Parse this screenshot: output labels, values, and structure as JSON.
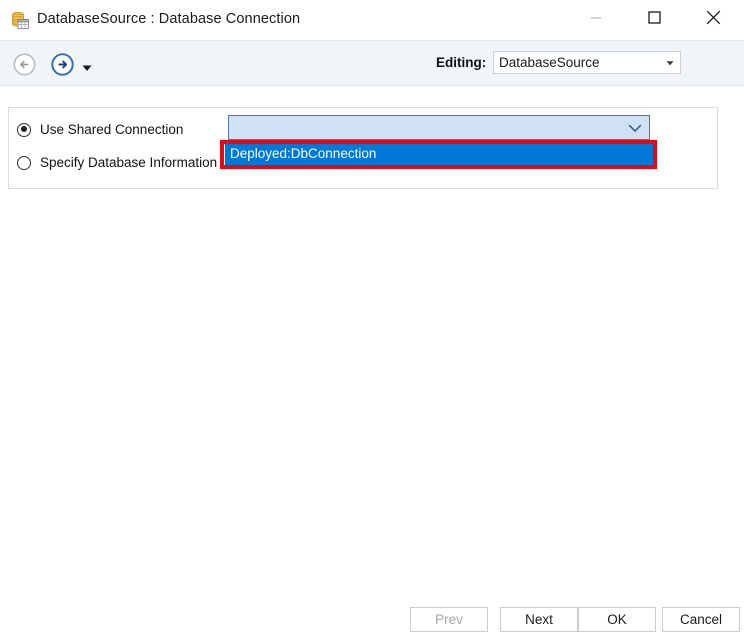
{
  "window": {
    "title": "DatabaseSource : Database Connection",
    "icon": "database-table-icon",
    "controls": {
      "minimize": "minimize-icon",
      "maximize": "maximize-icon",
      "close": "close-icon"
    }
  },
  "toolbar": {
    "back_icon": "back-arrow-icon",
    "forward_icon": "forward-arrow-icon",
    "history_caret_icon": "chevron-down-icon",
    "editing_label": "Editing:",
    "editing_value": "DatabaseSource",
    "editing_dropdown_icon": "chevron-down-icon"
  },
  "options": {
    "radios": [
      {
        "label": "Use Shared Connection",
        "checked": true
      },
      {
        "label": "Specify Database Information",
        "checked": false
      }
    ]
  },
  "connection_combo": {
    "value": "",
    "placeholder": "",
    "chevron_icon": "chevron-down-icon",
    "expanded": true,
    "items": [
      {
        "label": "Deployed:DbConnection",
        "selected": true
      }
    ]
  },
  "annotation": {
    "shape": "rectangle",
    "color": "#e50914",
    "target": "Deployed:DbConnection"
  },
  "footer": {
    "buttons": [
      {
        "label": "Prev",
        "enabled": false
      },
      {
        "label": "Next",
        "enabled": true
      },
      {
        "label": "OK",
        "enabled": true
      },
      {
        "label": "Cancel",
        "enabled": true
      }
    ]
  },
  "colors": {
    "accent_highlight": "#0078d7",
    "combo_fill": "#cfe2f5",
    "annotation": "#e50914",
    "toolbar_bg": "#f1f5f9"
  }
}
